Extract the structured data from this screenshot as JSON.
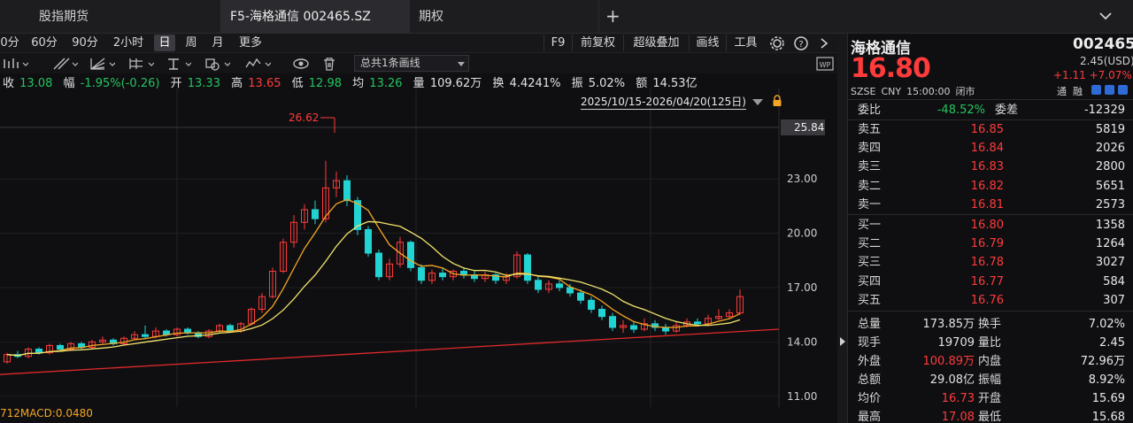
{
  "tabs": [
    {
      "label": "股指期货",
      "active": false
    },
    {
      "label": "F5-海格通信 002465.SZ",
      "active": true
    },
    {
      "label": "期权",
      "active": false
    }
  ],
  "tab_add_icon": "plus-icon",
  "tab_menu_icon": "chevron-down-icon",
  "periods": [
    "0分",
    "60分",
    "90分",
    "2小时",
    "日",
    "周",
    "月",
    "更多"
  ],
  "active_period": "日",
  "right_tools": [
    "F9",
    "前复权",
    "超级叠加",
    "画线",
    "工具"
  ],
  "right_tool_icons": [
    "gear-icon",
    "help-icon",
    "chevron-right-icon"
  ],
  "draw_toolbar": {
    "selector_text": "总共1条画线",
    "icons": [
      "bar-tool-icon",
      "trend-line-icon",
      "fan-icon",
      "parallel-icon",
      "price-label-icon",
      "shape-icon",
      "wave-icon",
      "eye-icon",
      "trash-icon",
      "wp-icon"
    ]
  },
  "quote": {
    "close_label": "收",
    "close": "13.08",
    "range_label": "幅",
    "range": "-1.95%(-0.26)",
    "open_label": "开",
    "open": "13.33",
    "high_label": "高",
    "high": "13.65",
    "low_label": "低",
    "low": "12.98",
    "avg_label": "均",
    "avg": "13.26",
    "vol_label": "量",
    "vol": "109.62万",
    "turn_label": "换",
    "turn": "4.4241%",
    "amp_label": "振",
    "amp": "5.02%",
    "amt_label": "额",
    "amt": "14.53亿"
  },
  "date_range": "2025/10/15-2026/04/20(125日)",
  "chart_data": {
    "type": "candlestick",
    "y_ticks": [
      "23.00",
      "20.00",
      "17.00",
      "14.00",
      "11.00"
    ],
    "ylim": [
      10.5,
      27.5
    ],
    "current_price_label": "25.84",
    "high_marker": "26.62",
    "colors": {
      "up": "#ff3b3b",
      "down": "#22d3d3",
      "ma5": "#f5a623",
      "ma10": "#f2e46b",
      "trend": "#e02a2a"
    },
    "candles": [
      [
        12.9,
        13.3,
        12.8,
        13.4
      ],
      [
        13.3,
        13.2,
        13.1,
        13.5
      ],
      [
        13.2,
        13.6,
        13.1,
        13.7
      ],
      [
        13.6,
        13.4,
        13.3,
        13.7
      ],
      [
        13.4,
        13.8,
        13.3,
        13.9
      ],
      [
        13.8,
        13.6,
        13.5,
        13.9
      ],
      [
        13.6,
        13.9,
        13.5,
        14.0
      ],
      [
        13.9,
        13.7,
        13.6,
        14.0
      ],
      [
        13.7,
        14.0,
        13.6,
        14.1
      ],
      [
        14.0,
        14.1,
        13.9,
        14.3
      ],
      [
        14.1,
        13.9,
        13.8,
        14.2
      ],
      [
        13.9,
        14.2,
        13.8,
        14.3
      ],
      [
        14.2,
        14.4,
        14.1,
        14.6
      ],
      [
        14.4,
        14.3,
        14.2,
        14.9
      ],
      [
        14.3,
        14.6,
        14.2,
        14.8
      ],
      [
        14.6,
        14.4,
        14.3,
        14.7
      ],
      [
        14.4,
        14.7,
        14.3,
        14.8
      ],
      [
        14.7,
        14.5,
        14.4,
        14.8
      ],
      [
        14.5,
        14.3,
        14.2,
        14.6
      ],
      [
        14.3,
        14.6,
        14.2,
        14.7
      ],
      [
        14.6,
        14.9,
        14.5,
        15.0
      ],
      [
        14.9,
        14.6,
        14.5,
        15.0
      ],
      [
        14.6,
        15.0,
        14.5,
        15.1
      ],
      [
        15.0,
        15.8,
        14.9,
        15.9
      ],
      [
        15.8,
        16.5,
        15.6,
        16.7
      ],
      [
        16.5,
        17.9,
        16.4,
        18.1
      ],
      [
        17.9,
        19.5,
        17.8,
        19.7
      ],
      [
        19.5,
        20.6,
        19.2,
        21.0
      ],
      [
        20.6,
        21.3,
        20.2,
        21.6
      ],
      [
        21.3,
        20.8,
        20.5,
        21.8
      ],
      [
        20.8,
        22.5,
        20.6,
        24.0
      ],
      [
        22.5,
        22.9,
        22.0,
        23.4
      ],
      [
        22.9,
        21.8,
        21.5,
        23.2
      ],
      [
        21.8,
        20.2,
        19.9,
        22.0
      ],
      [
        20.2,
        18.9,
        18.7,
        20.4
      ],
      [
        18.9,
        17.6,
        17.4,
        19.1
      ],
      [
        17.6,
        18.3,
        17.4,
        18.6
      ],
      [
        18.3,
        19.5,
        18.1,
        19.8
      ],
      [
        19.5,
        18.1,
        17.9,
        19.6
      ],
      [
        18.1,
        17.4,
        17.2,
        18.3
      ],
      [
        17.4,
        17.8,
        17.2,
        18.0
      ],
      [
        17.8,
        17.6,
        17.4,
        18.1
      ],
      [
        17.6,
        17.9,
        17.4,
        18.0
      ],
      [
        17.9,
        17.7,
        17.5,
        18.1
      ],
      [
        17.7,
        17.5,
        17.3,
        17.9
      ],
      [
        17.5,
        17.7,
        17.3,
        17.9
      ],
      [
        17.7,
        17.4,
        17.2,
        17.8
      ],
      [
        17.4,
        17.6,
        17.2,
        17.8
      ],
      [
        17.6,
        18.8,
        17.5,
        19.0
      ],
      [
        18.8,
        17.4,
        17.2,
        18.9
      ],
      [
        17.4,
        16.9,
        16.7,
        17.6
      ],
      [
        16.9,
        17.2,
        16.7,
        17.4
      ],
      [
        17.2,
        17.0,
        16.8,
        17.4
      ],
      [
        17.0,
        16.7,
        16.5,
        17.2
      ],
      [
        16.7,
        16.3,
        16.1,
        16.9
      ],
      [
        16.3,
        15.8,
        15.6,
        16.5
      ],
      [
        15.8,
        15.4,
        15.2,
        16.0
      ],
      [
        15.4,
        14.8,
        14.6,
        15.6
      ],
      [
        14.8,
        14.9,
        14.5,
        15.2
      ],
      [
        14.9,
        14.7,
        14.5,
        15.1
      ],
      [
        14.7,
        15.0,
        14.6,
        15.3
      ],
      [
        15.0,
        14.8,
        14.6,
        15.2
      ],
      [
        14.8,
        14.6,
        14.4,
        15.0
      ],
      [
        14.6,
        14.9,
        14.5,
        15.1
      ],
      [
        14.9,
        15.1,
        14.8,
        15.3
      ],
      [
        15.1,
        15.0,
        14.9,
        15.3
      ],
      [
        15.0,
        15.3,
        14.9,
        15.5
      ],
      [
        15.3,
        15.4,
        15.2,
        15.8
      ],
      [
        15.4,
        15.6,
        15.3,
        15.8
      ],
      [
        15.6,
        16.5,
        15.5,
        16.9
      ]
    ]
  },
  "macd_label": "712MACD:0.0480",
  "panel": {
    "name": "海格通信",
    "code": "002465",
    "price": "16.80",
    "usd": "2.45(USD)",
    "change": "+1.11",
    "change_pct": "+7.07%",
    "market": "SZSE",
    "currency": "CNY",
    "time": "15:00:00",
    "status": "闭市",
    "tong": "通",
    "rong": "融",
    "weibi_label": "委比",
    "weibi": "-48.52%",
    "weicha_label": "委差",
    "weicha": "-12329",
    "asks": [
      {
        "label": "卖五",
        "price": "16.85",
        "vol": "5819"
      },
      {
        "label": "卖四",
        "price": "16.84",
        "vol": "2026"
      },
      {
        "label": "卖三",
        "price": "16.83",
        "vol": "2800"
      },
      {
        "label": "卖二",
        "price": "16.82",
        "vol": "5651"
      },
      {
        "label": "卖一",
        "price": "16.81",
        "vol": "2573"
      }
    ],
    "bids": [
      {
        "label": "买一",
        "price": "16.80",
        "vol": "1358"
      },
      {
        "label": "买二",
        "price": "16.79",
        "vol": "1264"
      },
      {
        "label": "买三",
        "price": "16.78",
        "vol": "3027"
      },
      {
        "label": "买四",
        "price": "16.77",
        "vol": "584"
      },
      {
        "label": "买五",
        "price": "16.76",
        "vol": "307"
      }
    ],
    "stats": [
      {
        "l1": "总量",
        "v1": "173.85万",
        "l2": "换手",
        "v2": "7.02%",
        "c1": "neutral",
        "c2": "neutral"
      },
      {
        "l1": "现手",
        "v1": "19709",
        "l2": "量比",
        "v2": "2.45",
        "c1": "neutral",
        "c2": "neutral"
      },
      {
        "l1": "外盘",
        "v1": "100.89万",
        "l2": "内盘",
        "v2": "72.96万",
        "c1": "up",
        "c2": "down"
      },
      {
        "l1": "总额",
        "v1": "29.08亿",
        "l2": "振幅",
        "v2": "8.92%",
        "c1": "neutral",
        "c2": "neutral"
      },
      {
        "l1": "均价",
        "v1": "16.73",
        "l2": "开盘",
        "v2": "15.69",
        "c1": "up",
        "c2": "neutral"
      },
      {
        "l1": "最高",
        "v1": "17.08",
        "l2": "最低",
        "v2": "15.68",
        "c1": "up",
        "c2": "down"
      }
    ]
  }
}
